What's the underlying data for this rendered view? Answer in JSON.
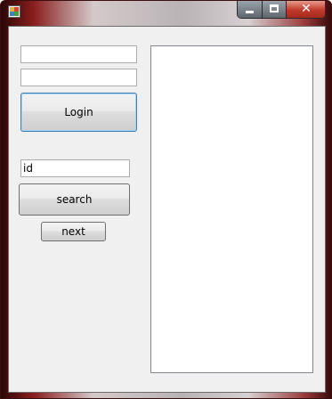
{
  "window": {
    "title": ""
  },
  "login": {
    "username_value": "",
    "password_value": "",
    "login_label": "Login"
  },
  "search": {
    "id_value": "id",
    "search_label": "search",
    "next_label": "next"
  },
  "results": {
    "items": []
  }
}
